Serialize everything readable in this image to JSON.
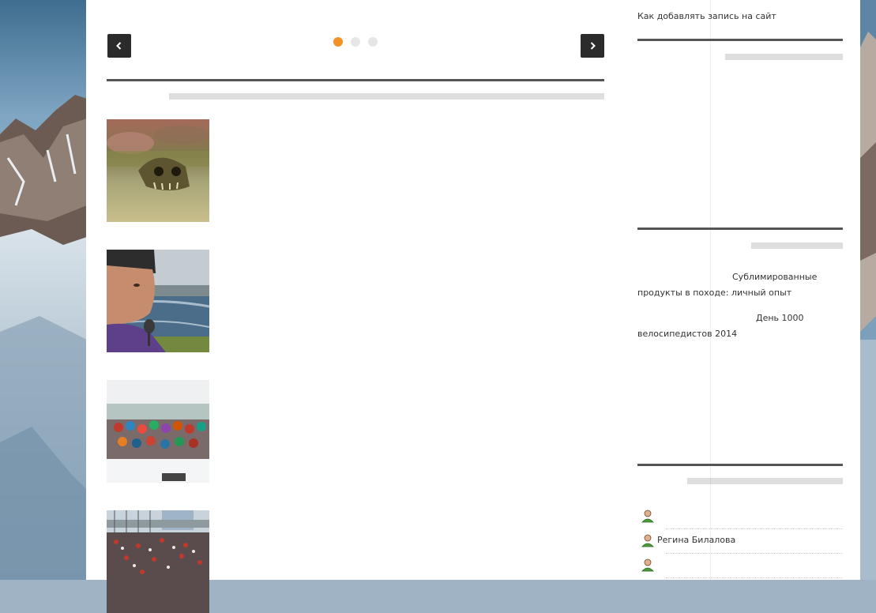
{
  "sidebar": {
    "add_post_link": "Как добавлять запись на сайт",
    "popular_posts": [
      {
        "label": "Сублимированные продукты в походе: личный опыт"
      },
      {
        "label": "День 1000 велосипедистов 2014"
      }
    ],
    "users": [
      {
        "name": ""
      },
      {
        "name": "Регина Билалова"
      },
      {
        "name": ""
      }
    ]
  },
  "slider": {
    "dot_count": 3,
    "active_dot": 0,
    "accent_color": "#f29226"
  },
  "thumbnails": [
    {
      "icon": "skull-on-table-image"
    },
    {
      "icon": "hiker-portrait-image"
    },
    {
      "icon": "group-photo-snow-image"
    },
    {
      "icon": "crowd-cyclists-image"
    }
  ]
}
